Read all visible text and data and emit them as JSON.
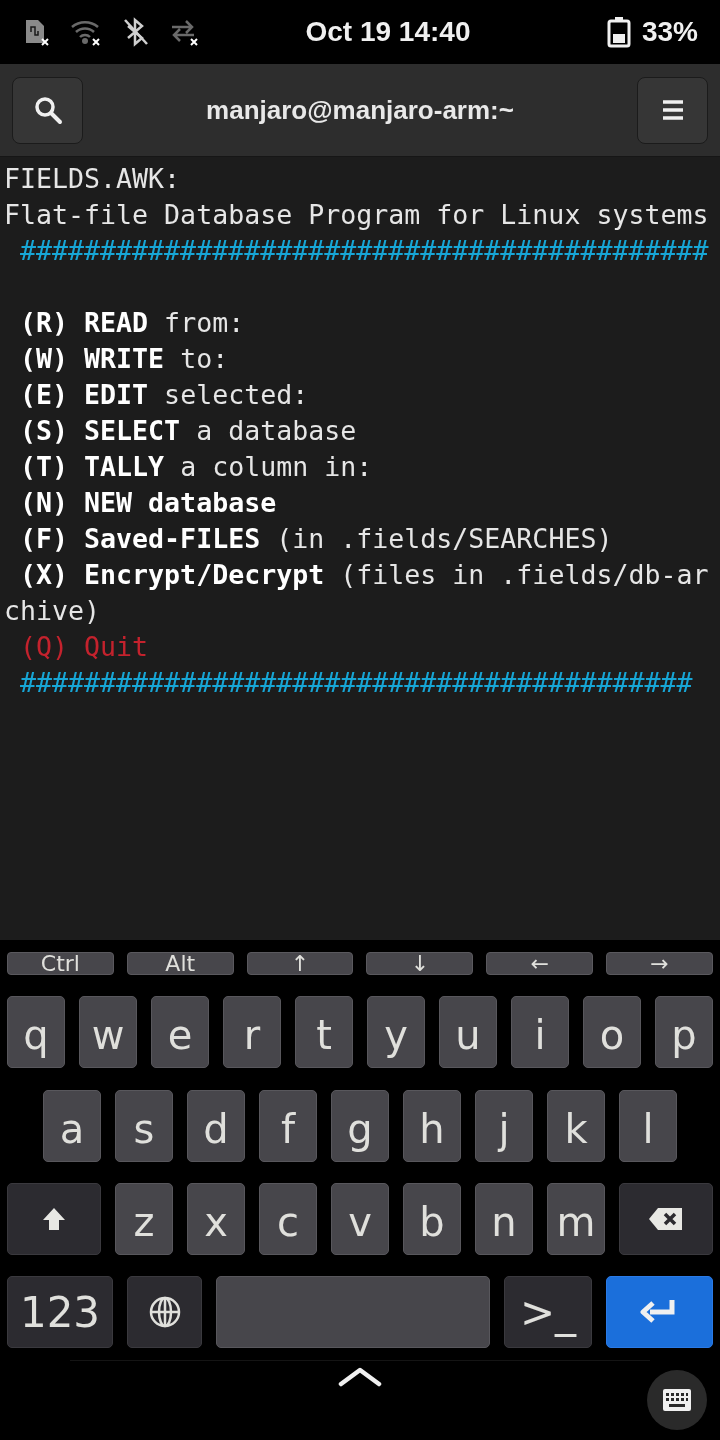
{
  "status_bar": {
    "date_time": "Oct 19  14:40",
    "battery": "33%"
  },
  "header": {
    "title": "manjaro@manjaro-arm:~"
  },
  "terminal": {
    "lines": [
      {
        "kind": "plain",
        "text": "FIELDS.AWK:"
      },
      {
        "kind": "plain",
        "text": "Flat-file Database Program for Linux systems"
      },
      {
        "kind": "rule",
        "text": " ###########################################"
      },
      {
        "kind": "blank"
      },
      {
        "kind": "plain",
        "text": " **(R) READ** from:"
      },
      {
        "kind": "plain",
        "text": " **(W) WRITE** to:"
      },
      {
        "kind": "plain",
        "text": " **(E) EDIT** selected:"
      },
      {
        "kind": "plain",
        "text": " **(S) SELECT** a database"
      },
      {
        "kind": "plain",
        "text": " **(T) TALLY** a column in:"
      },
      {
        "kind": "plain",
        "text": " **(N) NEW database**"
      },
      {
        "kind": "plain",
        "text": " **(F) Saved-FILES** (in .fields/SEARCHES)"
      },
      {
        "kind": "plain",
        "text": " **(X) Encrypt/Decrypt** (files in .fields/db-ar"
      },
      {
        "kind": "plain",
        "text": "chive)"
      },
      {
        "kind": "alert",
        "text": " (Q) Quit"
      },
      {
        "kind": "rule",
        "text": " ##########################################"
      }
    ]
  },
  "keyboard": {
    "modifier_keys": [
      "Ctrl",
      "Alt",
      "↑",
      "↓",
      "←",
      "→"
    ],
    "rows": [
      {
        "keys": [
          {
            "kind": "letter",
            "label": "q"
          },
          {
            "kind": "letter",
            "label": "w"
          },
          {
            "kind": "letter",
            "label": "e"
          },
          {
            "kind": "letter",
            "label": "r"
          },
          {
            "kind": "letter",
            "label": "t"
          },
          {
            "kind": "letter",
            "label": "y"
          },
          {
            "kind": "letter",
            "label": "u"
          },
          {
            "kind": "letter",
            "label": "i"
          },
          {
            "kind": "letter",
            "label": "o"
          },
          {
            "kind": "letter",
            "label": "p"
          }
        ]
      },
      {
        "keys": [
          {
            "kind": "letter",
            "label": "a"
          },
          {
            "kind": "letter",
            "label": "s"
          },
          {
            "kind": "letter",
            "label": "d"
          },
          {
            "kind": "letter",
            "label": "f"
          },
          {
            "kind": "letter",
            "label": "g"
          },
          {
            "kind": "letter",
            "label": "h"
          },
          {
            "kind": "letter",
            "label": "j"
          },
          {
            "kind": "letter",
            "label": "k"
          },
          {
            "kind": "letter",
            "label": "l"
          }
        ]
      },
      {
        "keys": [
          {
            "kind": "shift"
          },
          {
            "kind": "letter",
            "label": "z"
          },
          {
            "kind": "letter",
            "label": "x"
          },
          {
            "kind": "letter",
            "label": "c"
          },
          {
            "kind": "letter",
            "label": "v"
          },
          {
            "kind": "letter",
            "label": "b"
          },
          {
            "kind": "letter",
            "label": "n"
          },
          {
            "kind": "letter",
            "label": "m"
          },
          {
            "kind": "backspace"
          }
        ]
      },
      {
        "keys": [
          {
            "kind": "symbols",
            "label": "123"
          },
          {
            "kind": "globe"
          },
          {
            "kind": "space"
          },
          {
            "kind": "terminal",
            "label": ">_"
          },
          {
            "kind": "enter"
          }
        ]
      }
    ]
  }
}
